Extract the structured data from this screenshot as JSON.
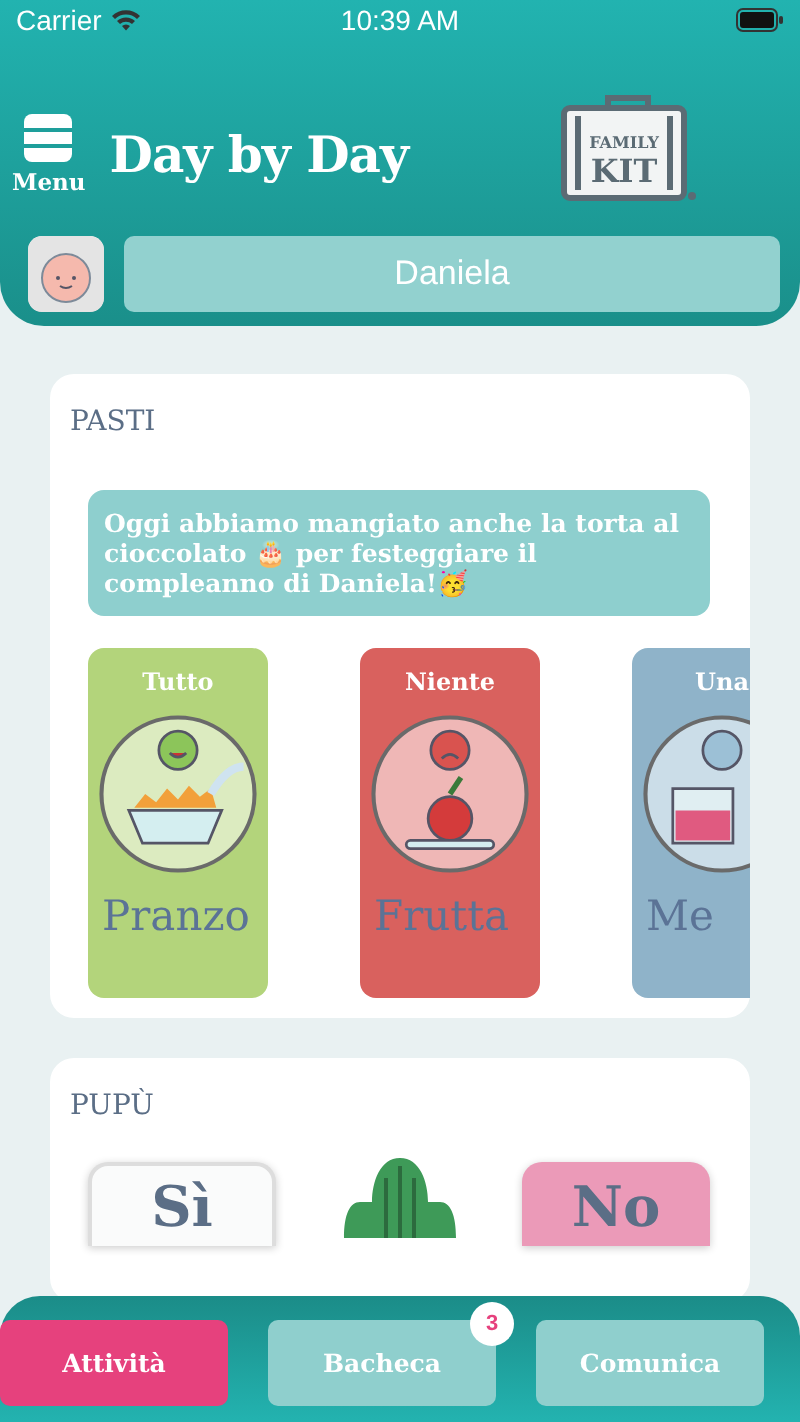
{
  "status_bar": {
    "carrier": "Carrier",
    "time": "10:39 AM"
  },
  "header": {
    "menu_label": "Menu",
    "title": "Day by Day",
    "logo": {
      "line_1": "FAMILY",
      "line_2": "KIT"
    },
    "child_name": "Daniela"
  },
  "sections": [
    {
      "kind": "meals",
      "title": "PASTI",
      "note": "Oggi abbiamo mangiato anche la torta al cioccolato 🎂 per festeggiare il compleanno di Daniela!🥳",
      "meals": [
        {
          "amount": "Tutto",
          "name": "Pranzo",
          "color": "#b3d47b",
          "kind": "cereal"
        },
        {
          "amount": "Niente",
          "name": "Frutta",
          "color": "#d9615e",
          "kind": "apple"
        },
        {
          "amount": "Una",
          "name": "Me",
          "color": "#8fb3c9",
          "kind": "drink"
        }
      ]
    },
    {
      "kind": "choice",
      "title": "PUPÙ",
      "options": [
        {
          "label": "Sì",
          "selected": false
        },
        {
          "label": "No",
          "selected": true
        }
      ]
    }
  ],
  "tabs": [
    {
      "label": "Attività",
      "selected": true
    },
    {
      "label": "Bacheca",
      "selected": false,
      "badge": "3"
    },
    {
      "label": "Comunica",
      "selected": false
    }
  ]
}
